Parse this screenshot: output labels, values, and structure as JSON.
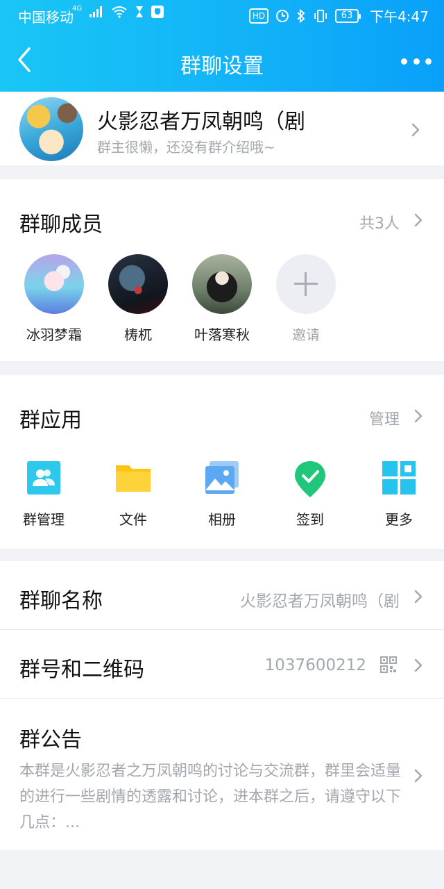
{
  "status_bar": {
    "carrier": "中国移动",
    "network": "4G",
    "battery": "63",
    "time": "下午4:47",
    "hd": "HD"
  },
  "nav": {
    "title": "群聊设置"
  },
  "group": {
    "name": "火影忍者万凤朝鸣（剧",
    "description": "群主很懒，还没有群介绍哦~"
  },
  "members": {
    "title": "群聊成员",
    "count": "共3人",
    "list": [
      {
        "name": "冰羽梦霜"
      },
      {
        "name": "梼杌"
      },
      {
        "name": "叶落寒秋"
      },
      {
        "name": "邀请"
      }
    ]
  },
  "apps": {
    "title": "群应用",
    "manage": "管理",
    "items": [
      {
        "label": "群管理",
        "icon": "group-manage-icon",
        "color": "#2cc9ec"
      },
      {
        "label": "文件",
        "icon": "folder-icon",
        "color": "#fdc414"
      },
      {
        "label": "相册",
        "icon": "album-icon",
        "color": "#5aa9f2"
      },
      {
        "label": "签到",
        "icon": "check-in-icon",
        "color": "#20c67a"
      },
      {
        "label": "更多",
        "icon": "more-apps-icon",
        "color": "#25c4ef"
      }
    ]
  },
  "rows": {
    "name_label": "群聊名称",
    "name_value": "火影忍者万凤朝鸣（剧",
    "code_label": "群号和二维码",
    "code_value": "1037600212",
    "notice_label": "群公告",
    "notice_text": "本群是火影忍者之万凤朝鸣的讨论与交流群，群里会适量的进行一些剧情的透露和讨论，进本群之后，请遵守以下几点：..."
  }
}
